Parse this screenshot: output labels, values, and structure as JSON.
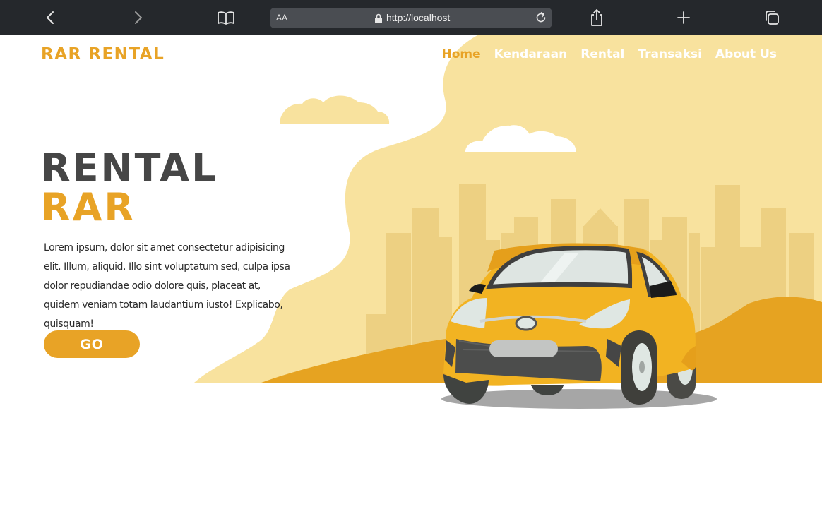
{
  "browser": {
    "url": "http://localhost",
    "text_size_label": "AA",
    "icons": [
      "back-icon",
      "forward-icon",
      "bookmarks-icon",
      "lock-icon",
      "reload-icon",
      "share-icon",
      "new-tab-icon",
      "tabs-icon"
    ]
  },
  "site": {
    "brand": "RAR RENTAL",
    "nav": [
      {
        "label": "Home",
        "active": true
      },
      {
        "label": "Kendaraan",
        "active": false
      },
      {
        "label": "Rental",
        "active": false
      },
      {
        "label": "Transaksi",
        "active": false
      },
      {
        "label": "About Us",
        "active": false
      }
    ]
  },
  "hero": {
    "title_line1": "RENTAL",
    "title_line2": "RAR",
    "description": "Lorem ipsum, dolor sit amet consectetur adipisicing elit. Illum, aliquid. Illo sint voluptatum sed, culpa ipsa dolor repudiandae odio dolore quis, placeat at, quidem veniam totam laudantium iusto! Explicabo, quisquam!",
    "cta_label": "GO"
  },
  "colors": {
    "toolbar": "#25282c",
    "accent": "#e8a326",
    "title_dark": "#464646",
    "blob": "#f8e29e",
    "buildings": "#edd082",
    "hill": "#e6a321",
    "car_body": "#f2b322"
  }
}
